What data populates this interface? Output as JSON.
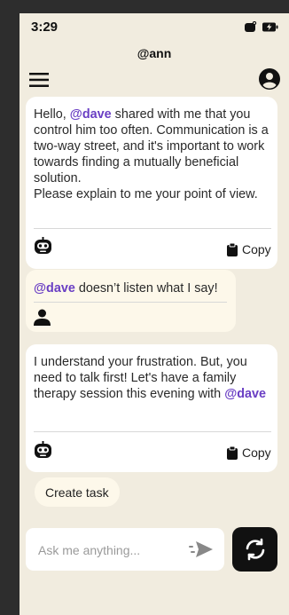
{
  "status": {
    "time": "3:29"
  },
  "header": {
    "handle": "@ann"
  },
  "icons": {
    "menu": "menu-icon",
    "profile": "account-circle-icon",
    "bot": "robot-icon",
    "user": "person-icon",
    "copy": "clipboard-icon",
    "send": "send-icon",
    "refresh": "refresh-icon"
  },
  "messages": [
    {
      "role": "bot",
      "part1": "Hello, ",
      "mention": "@dave",
      "part2": " shared with me that you control him too often. Communication is a two-way street, and it's important to work towards finding a mutually beneficial solution.\nPlease explain to me your point of view.",
      "copy_label": "Copy"
    },
    {
      "role": "user",
      "mention": "@dave",
      "part2": " doesn’t listen what I say!"
    },
    {
      "role": "bot",
      "part1": "I understand your frustration. But, you need to talk first! Let's have a family therapy session this evening with ",
      "mention": "@dave",
      "copy_label": "Copy"
    }
  ],
  "actions": {
    "create_task": "Create task"
  },
  "composer": {
    "placeholder": "Ask me anything..."
  },
  "colors": {
    "background": "#f1ecdf",
    "mention": "#6a3fc4",
    "user_bubble": "#fdf8ea",
    "bot_bubble": "#ffffff"
  }
}
